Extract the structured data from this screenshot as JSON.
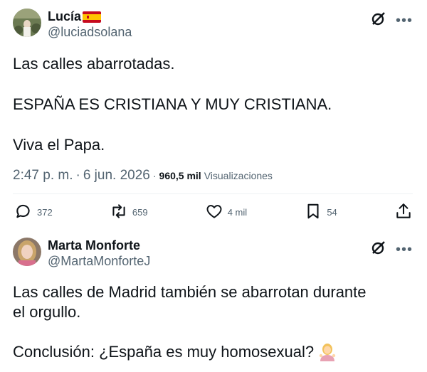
{
  "tweet1": {
    "display_name": "Lucía",
    "handle": "@luciadsolana",
    "lines": [
      "Las calles abarrotadas.",
      "ESPAÑA ES CRISTIANA Y MUY CRISTIANA.",
      "Viva el Papa."
    ],
    "time": "2:47 p. m.",
    "sep1": "·",
    "date": "6 jun. 2026",
    "sep2": "·",
    "views_count": "960,5 mil",
    "views_label": "Visualizaciones",
    "replies": "372",
    "reposts": "659",
    "likes": "4 mil",
    "bookmarks": "54"
  },
  "tweet2": {
    "display_name": "Marta Monforte",
    "handle": "@MartaMonforteJ",
    "line1": "Las calles de Madrid también se abarrotan durante",
    "line2": "el orgullo.",
    "line3": "Conclusión: ¿España es muy homosexual?"
  },
  "colors": {
    "text": "#0f1419",
    "secondary": "#536471",
    "divider": "#eff3f4",
    "flag_red": "#c60b1e",
    "flag_yellow": "#ffc400"
  },
  "icons": {
    "grok": "grok-slash-circle-icon",
    "more": "more-dots-icon",
    "reply": "reply-bubble-icon",
    "repost": "repost-arrows-icon",
    "like": "heart-icon",
    "bookmark": "bookmark-icon",
    "share": "share-up-arrow-icon",
    "flag": "spain-flag-icon",
    "emoji": "woman-shrugging-emoji-icon"
  }
}
